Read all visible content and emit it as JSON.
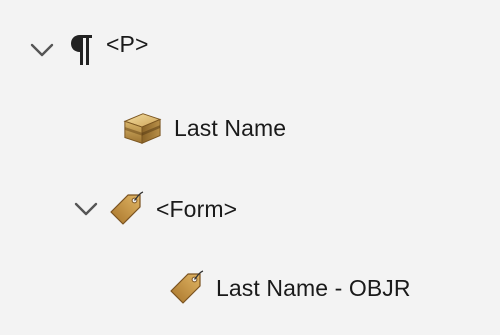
{
  "tree": {
    "nodes": [
      {
        "label": "<P>",
        "icon": "paragraph-icon",
        "expanded": true
      },
      {
        "label": "Last Name",
        "icon": "box-content-icon"
      },
      {
        "label": "<Form>",
        "icon": "tag-icon",
        "expanded": true
      },
      {
        "label": "Last Name - OBJR",
        "icon": "tag-icon"
      }
    ]
  },
  "colors": {
    "background": "#f3f3f3",
    "chevron": "#555555",
    "tag": "#c9953f",
    "box": "#c8a050"
  }
}
